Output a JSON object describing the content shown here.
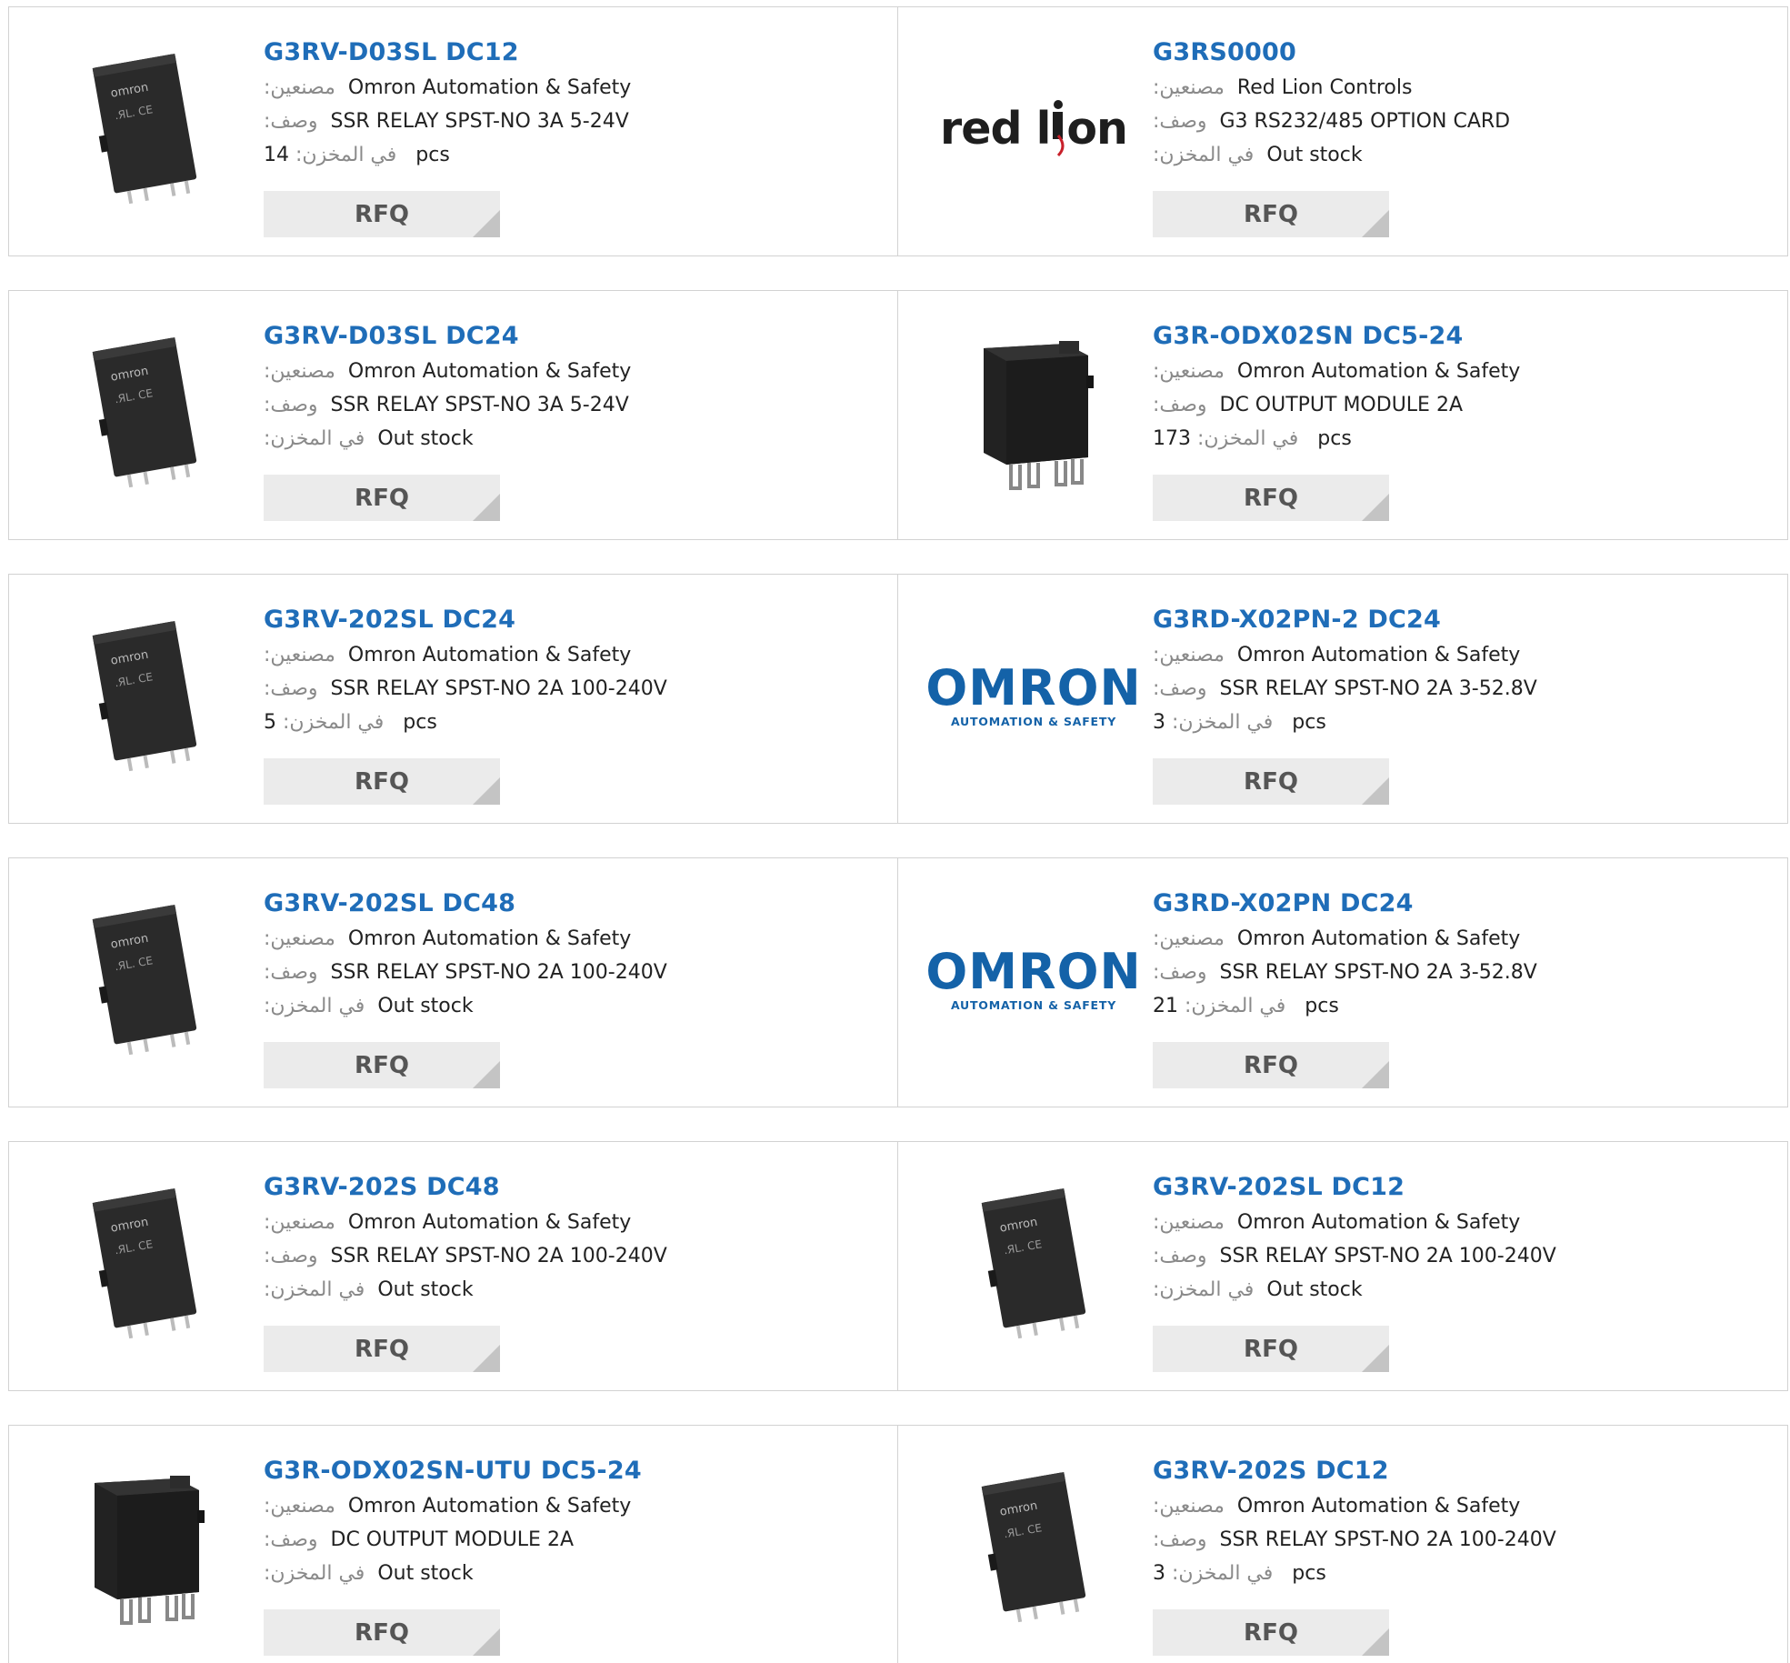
{
  "labels": {
    "manufacturer": ":مصنعين",
    "description": ":وصف",
    "stock": ":في المخزن",
    "stock_qty": "في المخزن:",
    "pcs": "pcs",
    "rfq": "RFQ"
  },
  "products": [
    {
      "part": "G3RV-D03SL DC12",
      "mfr": "Omron Automation & Safety",
      "desc": "SSR RELAY SPST-NO 3A 5-24V",
      "qty": "14",
      "stock": "",
      "image": "slim-relay-icon"
    },
    {
      "part": "G3RS0000",
      "mfr": "Red Lion Controls",
      "desc": "G3 RS232/485 OPTION CARD",
      "qty": "",
      "stock": "Out stock",
      "image": "red-lion-logo"
    },
    {
      "part": "G3RV-D03SL DC24",
      "mfr": "Omron Automation & Safety",
      "desc": "SSR RELAY SPST-NO 3A 5-24V",
      "qty": "",
      "stock": "Out stock",
      "image": "slim-relay-icon"
    },
    {
      "part": "G3R-ODX02SN DC5-24",
      "mfr": "Omron Automation & Safety",
      "desc": "DC OUTPUT MODULE 2A",
      "qty": "173",
      "stock": "",
      "image": "block-module-icon"
    },
    {
      "part": "G3RV-202SL DC24",
      "mfr": "Omron Automation & Safety",
      "desc": "SSR RELAY SPST-NO 2A 100-240V",
      "qty": "5",
      "stock": "",
      "image": "slim-relay-icon"
    },
    {
      "part": "G3RD-X02PN-2 DC24",
      "mfr": "Omron Automation & Safety",
      "desc": "SSR RELAY SPST-NO 2A 3-52.8V",
      "qty": "3",
      "stock": "",
      "image": "omron-logo"
    },
    {
      "part": "G3RV-202SL DC48",
      "mfr": "Omron Automation & Safety",
      "desc": "SSR RELAY SPST-NO 2A 100-240V",
      "qty": "",
      "stock": "Out stock",
      "image": "slim-relay-icon"
    },
    {
      "part": "G3RD-X02PN DC24",
      "mfr": "Omron Automation & Safety",
      "desc": "SSR RELAY SPST-NO 2A 3-52.8V",
      "qty": "21",
      "stock": "",
      "image": "omron-logo"
    },
    {
      "part": "G3RV-202S DC48",
      "mfr": "Omron Automation & Safety",
      "desc": "SSR RELAY SPST-NO 2A 100-240V",
      "qty": "",
      "stock": "Out stock",
      "image": "slim-relay-icon"
    },
    {
      "part": "G3RV-202SL DC12",
      "mfr": "Omron Automation & Safety",
      "desc": "SSR RELAY SPST-NO 2A 100-240V",
      "qty": "",
      "stock": "Out stock",
      "image": "slim-relay-icon"
    },
    {
      "part": "G3R-ODX02SN-UTU DC5-24",
      "mfr": "Omron Automation & Safety",
      "desc": "DC OUTPUT MODULE 2A",
      "qty": "",
      "stock": "Out stock",
      "image": "block-module-icon"
    },
    {
      "part": "G3RV-202S DC12",
      "mfr": "Omron Automation & Safety",
      "desc": "SSR RELAY SPST-NO 2A 100-240V",
      "qty": "3",
      "stock": "",
      "image": "slim-relay-icon"
    }
  ],
  "logos": {
    "red_lion": "red lion",
    "omron_big": "OMRON",
    "omron_small": "AUTOMATION & SAFETY"
  },
  "colors": {
    "part_link": "#1f6db8",
    "label": "#8a8a8a",
    "rfq_bg": "#ebebeb",
    "border": "#d2d2d2",
    "omron_blue": "#1462a8",
    "red_lion_red": "#c8202a"
  }
}
